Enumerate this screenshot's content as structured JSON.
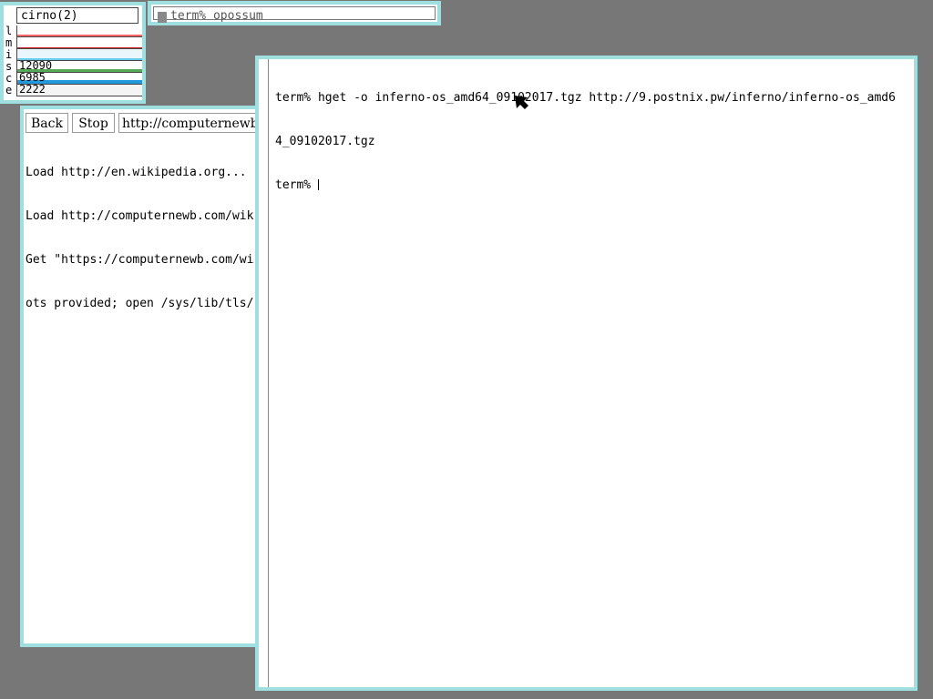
{
  "stats": {
    "title": "cirno(2)",
    "rows": [
      {
        "letter": "l",
        "value": "",
        "color": "#ff6666"
      },
      {
        "letter": "m",
        "value": "",
        "color": "#cc2222"
      },
      {
        "letter": "i",
        "value": "",
        "color": "#66ccee"
      },
      {
        "letter": "s",
        "value": "12090",
        "color": "#55aa55"
      },
      {
        "letter": "c",
        "value": "6985",
        "color": "#2299dd"
      },
      {
        "letter": "e",
        "value": "2222",
        "color": "#bbbbbb"
      }
    ]
  },
  "tag": {
    "text": "term% opossum"
  },
  "browser": {
    "back_label": "Back",
    "stop_label": "Stop",
    "url": "http://computernewb",
    "log": [
      "Load http://en.wikipedia.org...",
      "Load http://computernewb.com/wik",
      "Get \"https://computernewb.com/wi",
      "ots provided; open /sys/lib/tls/"
    ]
  },
  "terminal": {
    "line1": "term% hget -o inferno-os_amd64_09102017.tgz http://9.postnix.pw/inferno/inferno-os_amd6",
    "line2": "4_09102017.tgz",
    "prompt": "term% "
  },
  "colors": {
    "desktop": "#777777",
    "window_border": "#9fdfdf",
    "window_bg": "#ffffff"
  }
}
